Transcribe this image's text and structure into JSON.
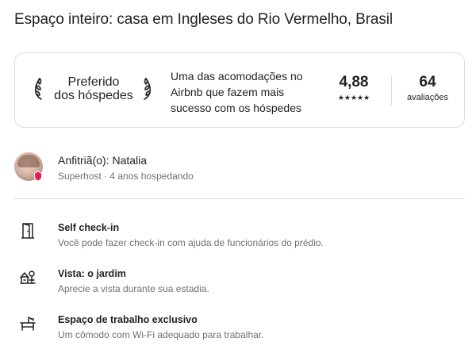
{
  "listing": {
    "title": "Espaço inteiro: casa em Ingleses do Rio Vermelho, Brasil"
  },
  "guest_favorite": {
    "badge_line1": "Preferido",
    "badge_line2": "dos hóspedes",
    "description": "Uma das acomodações no Airbnb que fazem mais sucesso com os hóspedes",
    "rating": "4,88",
    "stars": "★★★★★",
    "reviews_count": "64",
    "reviews_label": "avaliações"
  },
  "host": {
    "name_line": "Anfitriã(o): Natalia",
    "subtitle": "Superhost · 4 anos hospedando",
    "badge_color": "#e51d53"
  },
  "features": [
    {
      "icon": "door-icon",
      "title": "Self check-in",
      "description": "Você pode fazer check-in com ajuda de funcionários do prédio."
    },
    {
      "icon": "view-icon",
      "title": "Vista: o jardim",
      "description": "Aprecie a vista durante sua estadia."
    },
    {
      "icon": "desk-icon",
      "title": "Espaço de trabalho exclusivo",
      "description": "Um cômodo com Wi-Fi adequado para trabalhar."
    }
  ]
}
